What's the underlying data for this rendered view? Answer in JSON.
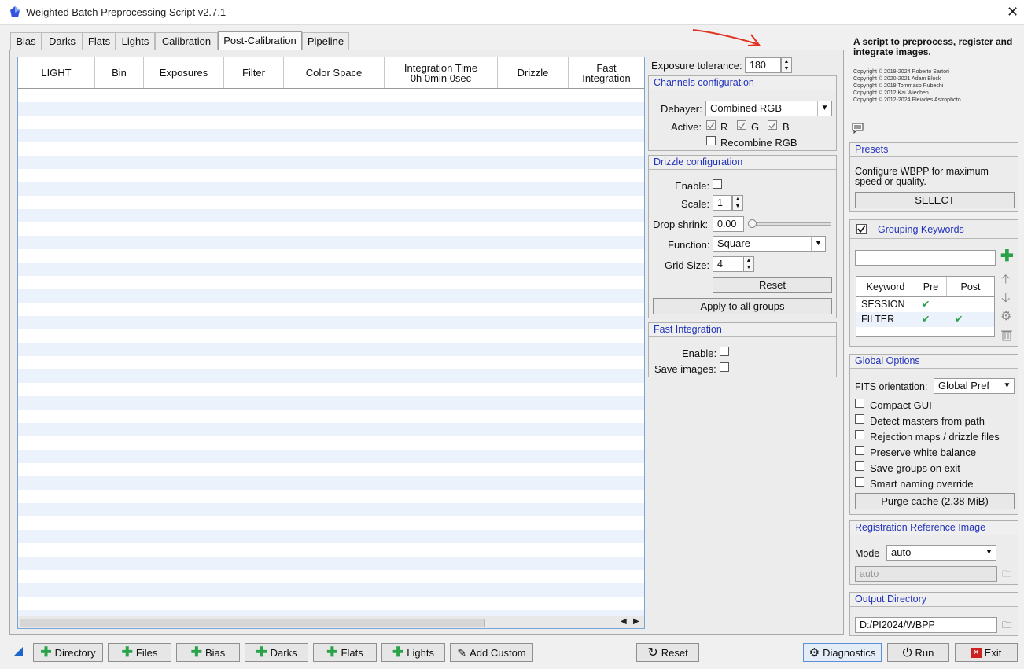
{
  "window": {
    "title": "Weighted Batch Preprocessing Script v2.7.1",
    "close_glyph": "✕"
  },
  "tabs": [
    "Bias",
    "Darks",
    "Flats",
    "Lights",
    "Calibration",
    "Post-Calibration",
    "Pipeline"
  ],
  "active_tab": "Post-Calibration",
  "table": {
    "columns": [
      {
        "line1": "LIGHT",
        "line2": ""
      },
      {
        "line1": "Bin",
        "line2": ""
      },
      {
        "line1": "Exposures",
        "line2": ""
      },
      {
        "line1": "Filter",
        "line2": ""
      },
      {
        "line1": "Color Space",
        "line2": ""
      },
      {
        "line1": "Integration Time",
        "line2": "0h  0min  0sec"
      },
      {
        "line1": "Drizzle",
        "line2": ""
      },
      {
        "line1": "Fast",
        "line2": "Integration"
      }
    ]
  },
  "exposure_tolerance": {
    "label": "Exposure tolerance:",
    "value": "180"
  },
  "channels": {
    "title": "Channels configuration",
    "debayer_label": "Debayer:",
    "debayer_value": "Combined RGB",
    "active_label": "Active:",
    "r": "R",
    "g": "G",
    "b": "B",
    "recombine": "Recombine RGB"
  },
  "drizzle": {
    "title": "Drizzle configuration",
    "enable_label": "Enable:",
    "scale_label": "Scale:",
    "scale_value": "1",
    "drop_label": "Drop shrink:",
    "drop_value": "0.00",
    "function_label": "Function:",
    "function_value": "Square",
    "grid_label": "Grid Size:",
    "grid_value": "4",
    "reset": "Reset",
    "apply_all": "Apply to all groups"
  },
  "fast_integration": {
    "title": "Fast Integration",
    "enable_label": "Enable:",
    "save_label": "Save images:"
  },
  "about": {
    "heading": "A script to preprocess, register and integrate images.",
    "copyright": [
      "Copyright © 2019-2024 Roberto Sartori",
      "Copyright © 2020-2021 Adam Block",
      "Copyright © 2019 Tommaso Rubechi",
      "Copyright © 2012 Kai Wiechen",
      "Copyright © 2012-2024 Pleiades Astrophoto"
    ]
  },
  "presets": {
    "title": "Presets",
    "text": "Configure WBPP for maximum speed or quality.",
    "select": "SELECT"
  },
  "grouping": {
    "title": "Grouping Keywords",
    "input_value": "",
    "headers": [
      "Keyword",
      "Pre",
      "Post"
    ],
    "rows": [
      {
        "keyword": "SESSION",
        "pre": "✔",
        "post": ""
      },
      {
        "keyword": "FILTER",
        "pre": "✔",
        "post": "✔"
      }
    ]
  },
  "global": {
    "title": "Global Options",
    "fits_label": "FITS orientation:",
    "fits_value": "Global Pref",
    "options": [
      "Compact GUI",
      "Detect masters from path",
      "Rejection maps / drizzle files",
      "Preserve white balance",
      "Save groups on exit",
      "Smart naming override"
    ],
    "purge": "Purge cache (2.38 MiB)"
  },
  "registration": {
    "title": "Registration Reference Image",
    "mode_label": "Mode",
    "mode_value": "auto",
    "path_value": "auto"
  },
  "output": {
    "title": "Output Directory",
    "path": "D:/PI2024/WBPP"
  },
  "bottom": {
    "directory": "Directory",
    "files": "Files",
    "bias": "Bias",
    "darks": "Darks",
    "flats": "Flats",
    "lights": "Lights",
    "add_custom": "Add Custom",
    "reset": "Reset",
    "diagnostics": "Diagnostics",
    "run": "Run",
    "exit": "Exit"
  },
  "colors": {
    "accent": "#2233bb",
    "plus": "#2aa24a",
    "exit": "#cc2222",
    "annotation": "#e0301e"
  }
}
